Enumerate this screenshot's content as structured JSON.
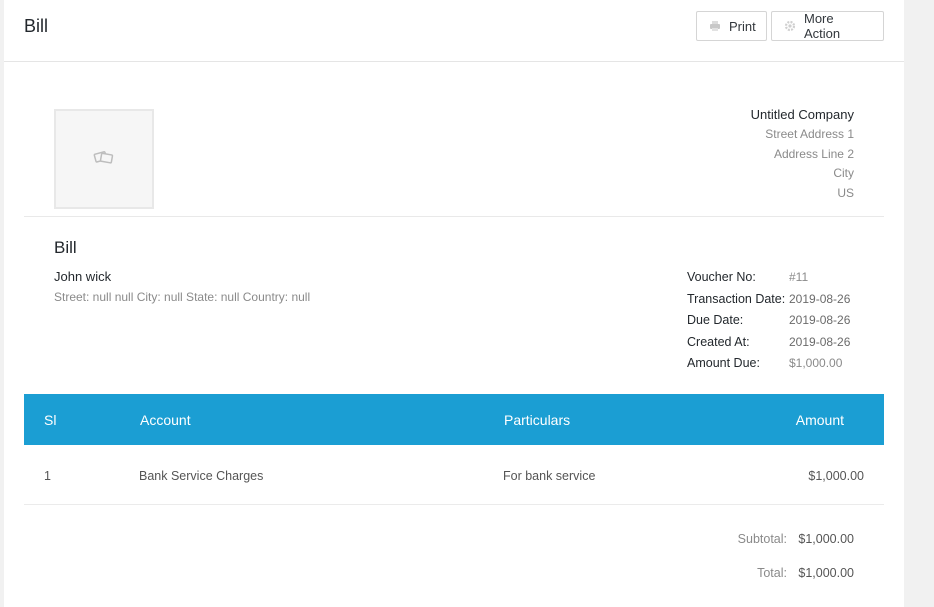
{
  "header": {
    "title": "Bill",
    "print_label": "Print",
    "more_action_label": "More Action"
  },
  "company": {
    "name": "Untitled Company",
    "street": "Street Address 1",
    "address2": "Address Line 2",
    "city": "City",
    "country": "US"
  },
  "bill": {
    "heading": "Bill",
    "customer_name": "John wick",
    "customer_address": "Street: null null City: null State: null Country: null"
  },
  "meta": [
    {
      "label": "Voucher No:",
      "value": "#11"
    },
    {
      "label": "Transaction Date:",
      "value": "2019-08-26"
    },
    {
      "label": "Due Date:",
      "value": "2019-08-26"
    },
    {
      "label": "Created At:",
      "value": "2019-08-26"
    },
    {
      "label": "Amount Due:",
      "value": "$1,000.00"
    }
  ],
  "table": {
    "headers": {
      "sl": "Sl",
      "account": "Account",
      "particulars": "Particulars",
      "amount": "Amount"
    },
    "rows": [
      {
        "sl": "1",
        "account": "Bank Service Charges",
        "particulars": "For bank service",
        "amount": "$1,000.00"
      }
    ]
  },
  "totals": {
    "subtotal_label": "Subtotal:",
    "subtotal_value": "$1,000.00",
    "total_label": "Total:",
    "total_value": "$1,000.00"
  },
  "colors": {
    "table_header_bg": "#1b9ed3",
    "panel_bg": "#ffffff",
    "page_bg": "#f1f1f1"
  },
  "icons": {
    "print": "printer-icon",
    "more_action": "gear-icon",
    "logo_placeholder": "image-placeholder-icon"
  }
}
